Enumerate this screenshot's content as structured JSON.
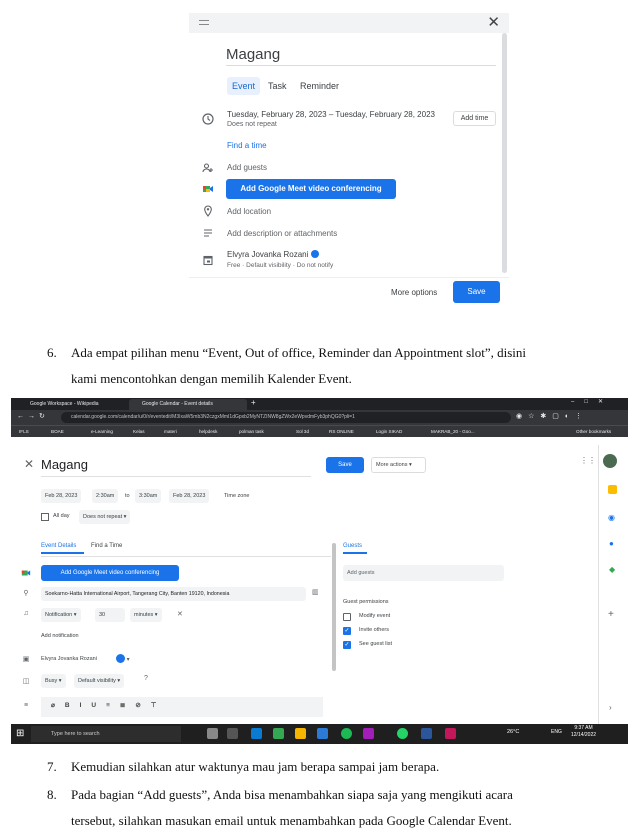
{
  "dialog": {
    "title": "Magang",
    "tabs": [
      "Event",
      "Task",
      "Reminder"
    ],
    "datetime": "Tuesday, February 28, 2023  –  Tuesday, February 28, 2023",
    "repeat": "Does not repeat",
    "add_time": "Add time",
    "find_time": "Find a time",
    "add_guests": "Add guests",
    "meet_button": "Add Google Meet video conferencing",
    "add_location": "Add location",
    "add_description": "Add description or attachments",
    "owner": "Elvyra Jovanka Rozani",
    "owner_sub": "Free · Default visibility · Do not notify",
    "more_options": "More options",
    "save": "Save"
  },
  "steps": [
    {
      "num": "6.",
      "line1": "Ada empat pilihan menu “Event, Out of office, Reminder dan Appointment slot”, disini",
      "line2": "kami mencontohkan dengan memilih Kalender Event."
    },
    {
      "num": "7.",
      "line1": "Kemudian silahkan atur waktunya mau jam berapa sampai jam berapa."
    },
    {
      "num": "8.",
      "line1": "Pada bagian “Add guests”, Anda bisa menambahkan siapa saja yang mengikuti acara",
      "line2": "tersebut, silahkan masukan email untuk menambahkan pada Google Calendar Event."
    }
  ],
  "browser": {
    "tabs": [
      "Google Workspace - Wikipedia",
      "Google Calendar - Event details"
    ],
    "url": "calendar.google.com/calendar/u/0/r/eventedit/M3IxaW5mb3N2czgxMmI1dGpxb2MyNTZINW8gZWx2eWpvdmFyb3phQG0?pli=1",
    "bookmarks": [
      "IFLS",
      "BOAE",
      "e-Learning",
      "Kelas",
      "materi",
      "helpdesk",
      "polman task",
      "Sol 3d",
      "RS ONLINE",
      "Login SIKAD",
      "MAKRAB_20 - Goo..."
    ],
    "other_bookmarks": "Other bookmarks"
  },
  "editor": {
    "title": "Magang",
    "save": "Save",
    "more_actions": "More actions",
    "start_date": "Feb 28, 2023",
    "start_time": "2:30am",
    "to": "to",
    "end_time": "3:30am",
    "end_date": "Feb 28, 2023",
    "time_zone": "Time zone",
    "all_day": "All day",
    "repeat": "Does not repeat",
    "tab_details": "Event Details",
    "tab_find": "Find a Time",
    "meet_button": "Add Google Meet video conferencing",
    "location": "Soekarno-Hatta International Airport, Tangerang City, Banten 19120, Indonesia",
    "notification": "Notification",
    "notif_value": "30",
    "notif_unit": "minutes",
    "add_notification": "Add notification",
    "owner": "Elvyra Jovanka Rozani",
    "busy": "Busy",
    "visibility": "Default visibility",
    "guests_tab": "Guests",
    "add_guests": "Add guests",
    "guest_permissions": "Guest permissions",
    "perm_modify": "Modify event",
    "perm_invite": "Invite others",
    "perm_see": "See guest list"
  },
  "taskbar": {
    "search": "Type here to search",
    "weather": "26°C",
    "lang": "ENG",
    "time": "9:37 AM",
    "date": "12/14/2022"
  }
}
